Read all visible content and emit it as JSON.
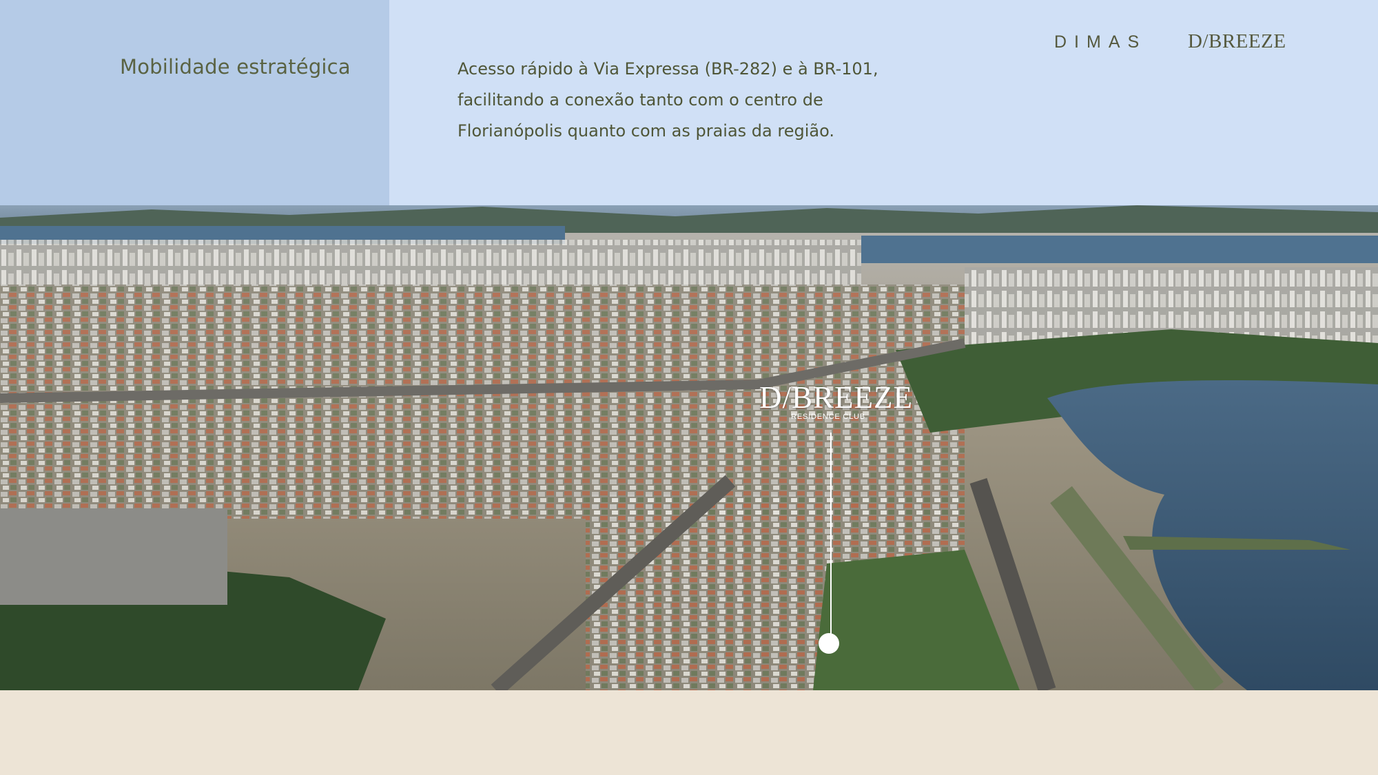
{
  "header": {
    "section_title": "Mobilidade estratégica",
    "description_lines": [
      "Acesso rápido à Via Expressa (BR-282) e à BR-101,",
      "facilitando a conexão tanto com o centro de",
      "Florianópolis quanto com as praias da região."
    ],
    "brand_dimas": "DIMAS",
    "brand_dbreeze": "D/BREEZE"
  },
  "map_marker": {
    "logo": "D/BREEZE",
    "subtitle": "RESIDENCE CLUB",
    "icon": "location-pin-icon"
  },
  "colors": {
    "header_left_bg": "#b5cbe7",
    "header_right_bg": "#d0e0f6",
    "text_olive": "#5a6343",
    "footer_bg": "#ede4d6"
  }
}
